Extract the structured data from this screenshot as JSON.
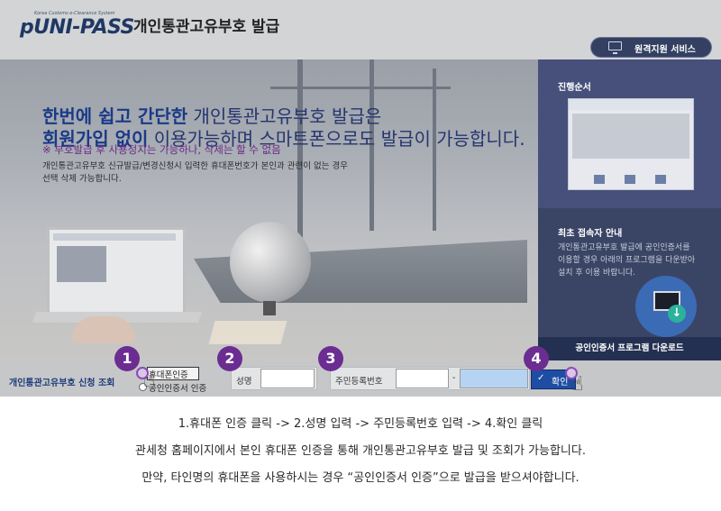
{
  "header": {
    "logo": "pUNI-PASS",
    "logo_tagline": "Korea Customs e-Clearance System",
    "title": "개인통관고유부호 발급",
    "remote_button": "원격지원 서비스"
  },
  "hero": {
    "line1_highlight_a": "한번에 쉽고 간단한",
    "line1_rest": " 개인통관고유부호 발급은",
    "line2_highlight": "회원가입 없이",
    "line2_rest": " 이용가능하며 스마트폰으로도 발급이 가능합니다.",
    "note": "※ 부호발급 후 사용정지는 가능하나, 삭제는 할 수 없음",
    "desc_line1": "개인통관고유부호 신규발급/변경신청시 입력한 휴대폰번호가 본인과 관련이 없는 경우",
    "desc_line2": "선택 삭제 가능합니다."
  },
  "side": {
    "progress_title": "진행순서",
    "first_user_title": "최초 접속자 안내",
    "first_user_desc_line1": "개인통관고유부호 발급에 공인인증서를",
    "first_user_desc_line2": "이용할 경우 아래의 프로그램을 다운받아",
    "first_user_desc_line3": "설치 후 이용 바랍니다.",
    "download_button": "공인인증서 프로그램 다운로드"
  },
  "form": {
    "label": "개인통관고유부호 신청 조회",
    "option_phone": "휴대폰인증",
    "option_cert": "공인인증서 인증",
    "name_label": "성명",
    "name_value": "",
    "rrn_label": "주민등록번호",
    "rrn_front": "",
    "rrn_sep": "-",
    "rrn_back": "",
    "confirm_label": "확인",
    "confirm_check": "✓",
    "steps": [
      "1",
      "2",
      "3",
      "4"
    ]
  },
  "instructions": {
    "line1": "1.휴대폰 인증 클릭 -> 2.성명 입력 -> 주민등록번호 입력 -> 4.확인 클릭",
    "line2": "관세청 홈페이지에서 본인 휴대폰 인증을 통해 개인통관고유부호 발급 및 조회가 가능합니다.",
    "line3": "만약, 타인명의 휴대폰을 사용하시는 경우 “공인인증서 인증”으로 발급을 받으셔야합니다."
  },
  "icons": {
    "remote": "monitor-icon",
    "download": "download-icon",
    "pointer": "hand-pointer-icon",
    "check": "check-icon"
  },
  "colors": {
    "header_bg": "#d3d4d6",
    "side_bg": "#3a4566",
    "step_badge": "#6b2d91",
    "confirm_btn": "#1e4ea4",
    "hero_text": "#25356e"
  }
}
